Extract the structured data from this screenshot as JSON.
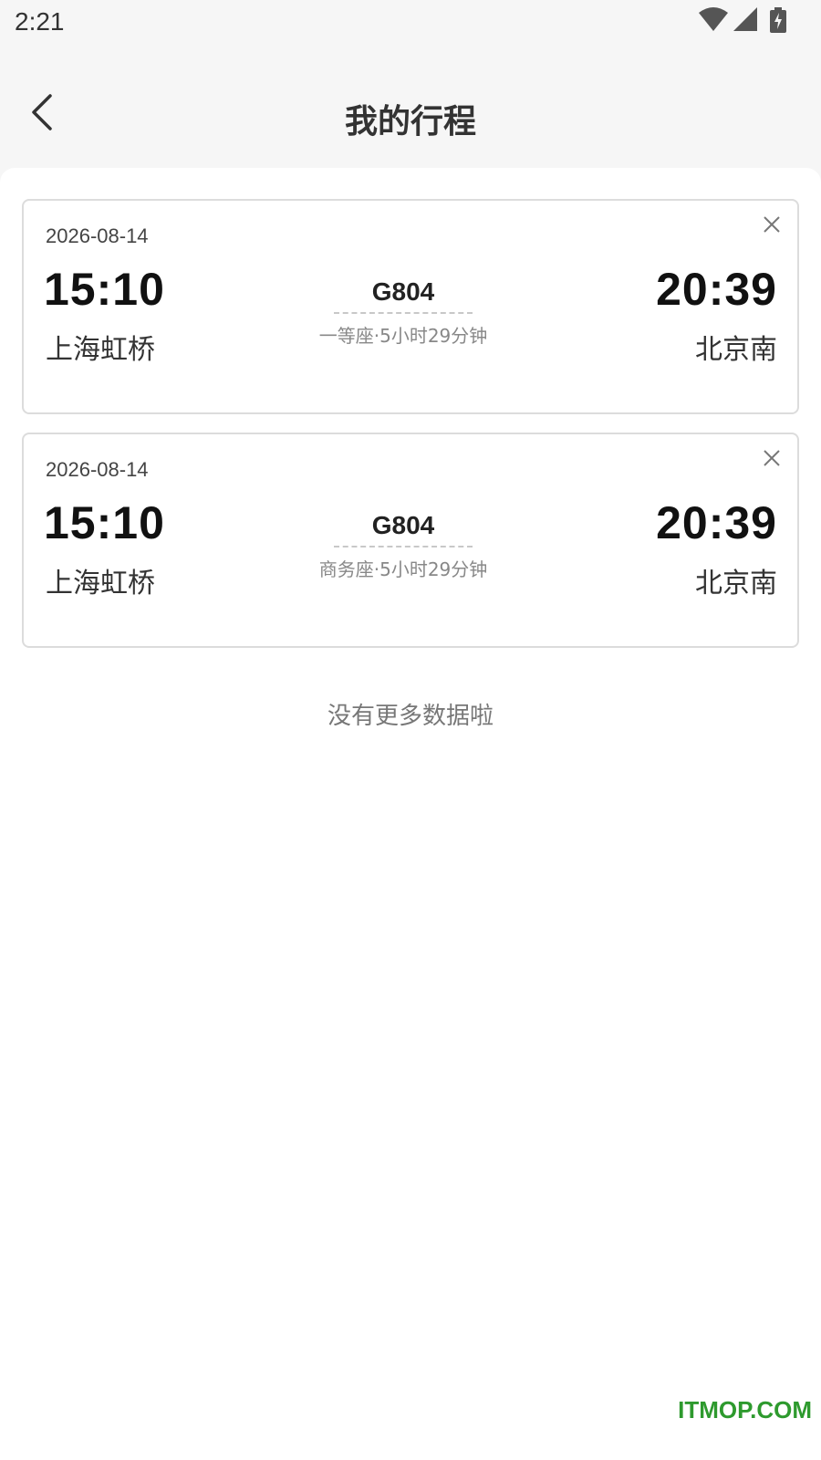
{
  "status_bar": {
    "time": "2:21",
    "icons": [
      "wifi-icon",
      "signal-icon",
      "battery-charging-icon"
    ]
  },
  "header": {
    "title": "我的行程",
    "back_icon": "chevron-left-icon"
  },
  "trips": [
    {
      "date": "2026-08-14",
      "depart_time": "15:10",
      "depart_station": "上海虹桥",
      "train_no": "G804",
      "seat_info": "一等座·5小时29分钟",
      "arrive_time": "20:39",
      "arrive_station": "北京南"
    },
    {
      "date": "2026-08-14",
      "depart_time": "15:10",
      "depart_station": "上海虹桥",
      "train_no": "G804",
      "seat_info": "商务座·5小时29分钟",
      "arrive_time": "20:39",
      "arrive_station": "北京南"
    }
  ],
  "footer_text": "没有更多数据啦",
  "watermark": "ITMOP.COM"
}
